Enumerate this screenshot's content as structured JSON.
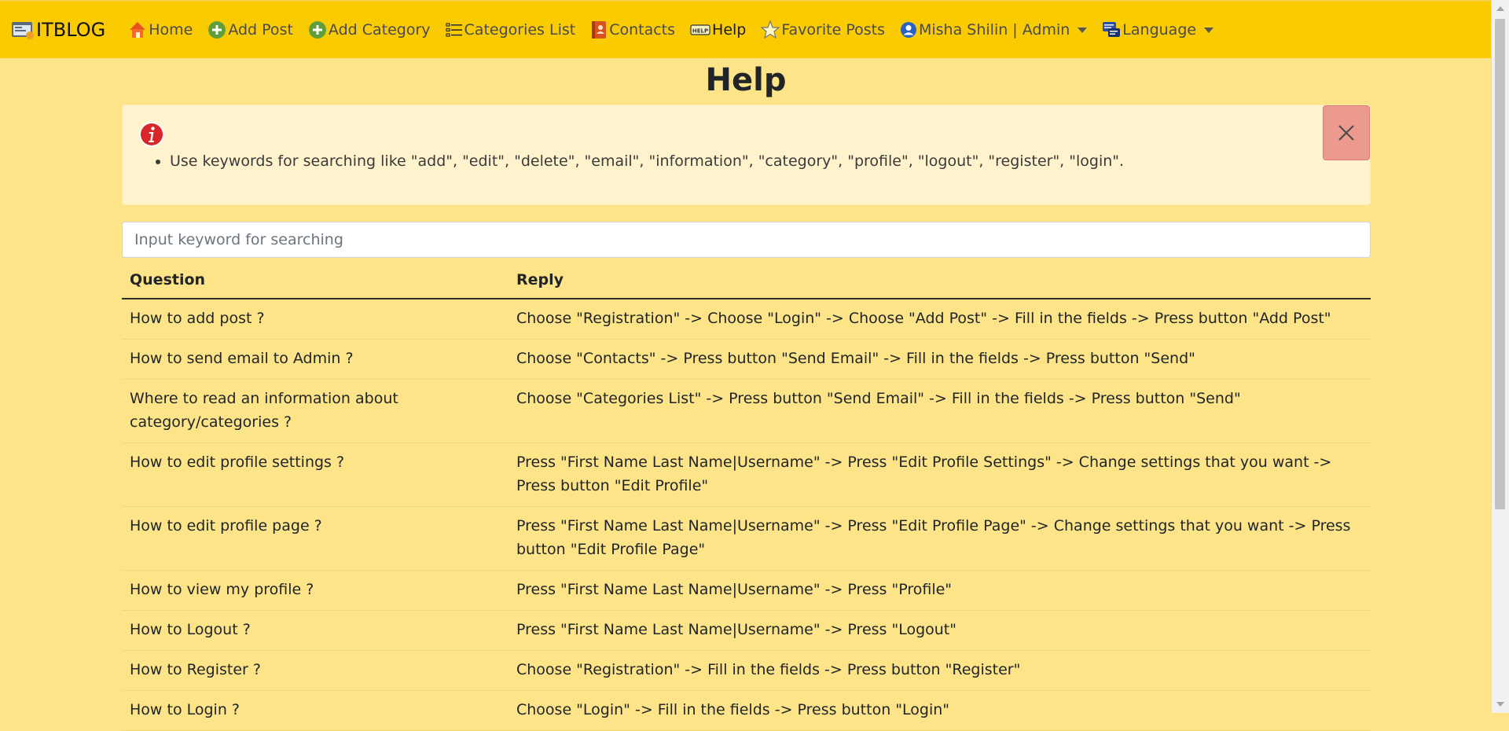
{
  "navbar": {
    "brand": "ITBLOG",
    "items": [
      {
        "label": "Home",
        "icon": "home-icon"
      },
      {
        "label": "Add Post",
        "icon": "plus-circle-icon"
      },
      {
        "label": "Add Category",
        "icon": "plus-circle-icon"
      },
      {
        "label": "Categories List",
        "icon": "list-icon"
      },
      {
        "label": "Contacts",
        "icon": "contacts-book-icon"
      },
      {
        "label": "Help",
        "icon": "help-sign-icon"
      },
      {
        "label": "Favorite Posts",
        "icon": "star-icon"
      },
      {
        "label": "Misha Shilin | Admin",
        "icon": "user-icon"
      },
      {
        "label": "Language",
        "icon": "language-icon"
      }
    ]
  },
  "page": {
    "title": "Help"
  },
  "alert": {
    "icon": "info-icon",
    "text": "Use keywords for searching like \"add\", \"edit\", \"delete\", \"email\", \"information\", \"category\", \"profile\", \"logout\", \"register\", \"login\"."
  },
  "search": {
    "placeholder": "Input keyword for searching",
    "value": ""
  },
  "table": {
    "headers": {
      "question": "Question",
      "reply": "Reply"
    },
    "rows": [
      {
        "q": "How to add post ?",
        "r": "Choose \"Registration\" -> Choose \"Login\" -> Choose \"Add Post\" -> Fill in the fields -> Press button \"Add Post\""
      },
      {
        "q": "How to send email to Admin ?",
        "r": "Choose \"Contacts\" -> Press button \"Send Email\" -> Fill in the fields -> Press button \"Send\""
      },
      {
        "q": "Where to read an information about category/categories ?",
        "r": "Choose \"Categories List\" -> Press button \"Send Email\" -> Fill in the fields -> Press button \"Send\""
      },
      {
        "q": "How to edit profile settings ?",
        "r": "Press \"First Name Last Name|Username\" -> Press \"Edit Profile Settings\" -> Change settings that you want -> Press button \"Edit Profile\""
      },
      {
        "q": "How to edit profile page ?",
        "r": "Press \"First Name Last Name|Username\" -> Press \"Edit Profile Page\" -> Change settings that you want -> Press button \"Edit Profile Page\""
      },
      {
        "q": "How to view my profile ?",
        "r": "Press \"First Name Last Name|Username\" -> Press \"Profile\""
      },
      {
        "q": "How to Logout ?",
        "r": "Press \"First Name Last Name|Username\" -> Press \"Logout\""
      },
      {
        "q": "How to Register ?",
        "r": "Choose \"Registration\" -> Fill in the fields -> Press button \"Register\""
      },
      {
        "q": "How to Login ?",
        "r": "Choose \"Login\" -> Fill in the fields -> Press button \"Login\""
      }
    ]
  }
}
